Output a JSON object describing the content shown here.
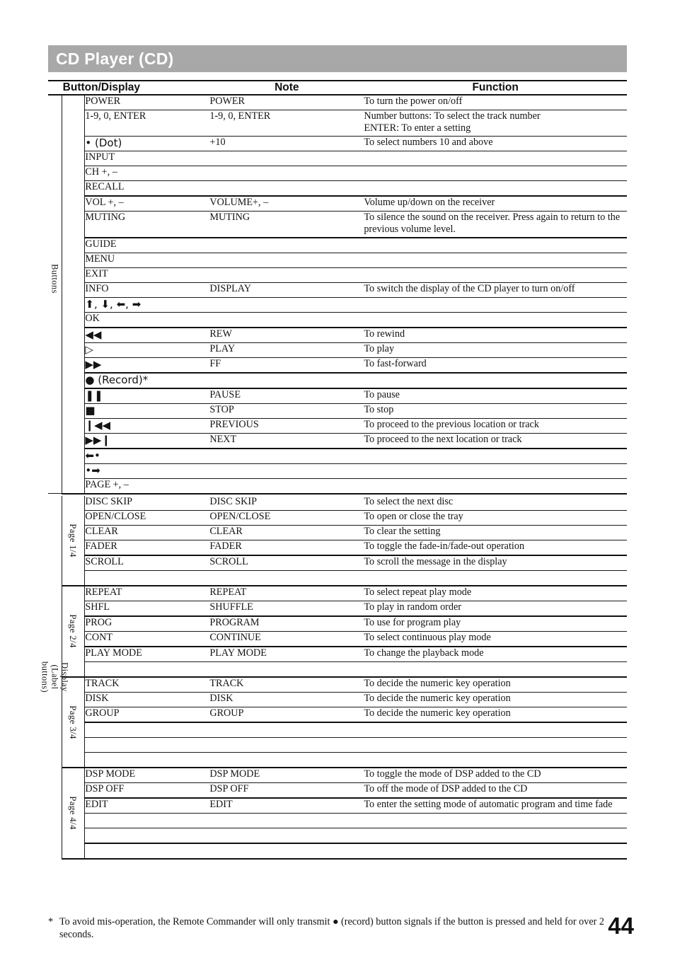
{
  "banner": {
    "title": "CD Player (CD)"
  },
  "headers": {
    "col1": "Button/Display",
    "col2": "Note",
    "col3": "Function"
  },
  "section_labels": {
    "buttons": "Buttons",
    "display": "Display\n(Label buttons)"
  },
  "page_labels": {
    "p1": "Page 1/4",
    "p2": "Page 2/4",
    "p3": "Page 3/4",
    "p4": "Page 4/4"
  },
  "buttons_rows": [
    {
      "bd": "POWER",
      "note": "POWER",
      "fn": "To turn the power on/off"
    },
    {
      "bd": "1-9, 0, ENTER",
      "note": "1-9, 0, ENTER",
      "fn": "Number buttons: To select the track number\nENTER: To enter a setting"
    },
    {
      "bd": "• (Dot)",
      "note": "+10",
      "fn": "To select numbers 10 and above"
    },
    {
      "bd": "INPUT",
      "note": "",
      "fn": ""
    },
    {
      "bd": "CH +, –",
      "note": "",
      "fn": ""
    },
    {
      "bd": "RECALL",
      "note": "",
      "fn": ""
    },
    {
      "bd": "VOL +, –",
      "note": "VOLUME+, –",
      "fn": "Volume up/down on the receiver"
    },
    {
      "bd": "MUTING",
      "note": "MUTING",
      "fn": "To silence the sound on the receiver. Press again to return to the\nprevious volume level."
    },
    {
      "bd": "GUIDE",
      "note": "",
      "fn": ""
    },
    {
      "bd": "MENU",
      "note": "",
      "fn": ""
    },
    {
      "bd": "EXIT",
      "note": "",
      "fn": ""
    },
    {
      "bd": "INFO",
      "note": "DISPLAY",
      "fn": "To switch the display of the CD player to turn on/off"
    },
    {
      "bd": "⬆, ⬇, ⬅, ➡",
      "note": "",
      "fn": ""
    },
    {
      "bd": "OK",
      "note": "",
      "fn": ""
    },
    {
      "bd": "◀◀",
      "note": "REW",
      "fn": "To rewind"
    },
    {
      "bd": "▷",
      "note": "PLAY",
      "fn": "To play"
    },
    {
      "bd": "▶▶",
      "note": "FF",
      "fn": "To fast-forward"
    },
    {
      "bd": "● (Record)*",
      "note": "",
      "fn": ""
    },
    {
      "bd": "❚❚",
      "note": "PAUSE",
      "fn": "To pause"
    },
    {
      "bd": "■",
      "note": "STOP",
      "fn": "To stop"
    },
    {
      "bd": "❙◀◀",
      "note": "PREVIOUS",
      "fn": "To proceed to the previous location or track"
    },
    {
      "bd": "▶▶❙",
      "note": "NEXT",
      "fn": "To proceed to the next location or track"
    },
    {
      "bd": "⬅•",
      "note": "",
      "fn": ""
    },
    {
      "bd": "•➡",
      "note": "",
      "fn": ""
    },
    {
      "bd": "PAGE +, –",
      "note": "",
      "fn": ""
    }
  ],
  "page1_rows": [
    {
      "bd": "DISC SKIP",
      "note": "DISC SKIP",
      "fn": "To select the next disc"
    },
    {
      "bd": "OPEN/CLOSE",
      "note": "OPEN/CLOSE",
      "fn": "To open or close the tray"
    },
    {
      "bd": "CLEAR",
      "note": "CLEAR",
      "fn": "To clear the setting"
    },
    {
      "bd": "FADER",
      "note": "FADER",
      "fn": "To toggle the fade-in/fade-out operation"
    },
    {
      "bd": "SCROLL",
      "note": "SCROLL",
      "fn": "To scroll the message in the display"
    },
    {
      "bd": "",
      "note": "",
      "fn": ""
    }
  ],
  "page2_rows": [
    {
      "bd": "REPEAT",
      "note": "REPEAT",
      "fn": "To select repeat play mode"
    },
    {
      "bd": "SHFL",
      "note": "SHUFFLE",
      "fn": "To play in random order"
    },
    {
      "bd": "PROG",
      "note": "PROGRAM",
      "fn": "To use for program play"
    },
    {
      "bd": "CONT",
      "note": "CONTINUE",
      "fn": "To select continuous play mode"
    },
    {
      "bd": "PLAY MODE",
      "note": "PLAY MODE",
      "fn": "To change the playback mode"
    },
    {
      "bd": "",
      "note": "",
      "fn": ""
    }
  ],
  "page3_rows": [
    {
      "bd": "TRACK",
      "note": "TRACK",
      "fn": "To decide the numeric key operation"
    },
    {
      "bd": "DISK",
      "note": "DISK",
      "fn": "To decide the numeric key operation"
    },
    {
      "bd": "GROUP",
      "note": "GROUP",
      "fn": "To decide the numeric key operation"
    },
    {
      "bd": "",
      "note": "",
      "fn": ""
    },
    {
      "bd": "",
      "note": "",
      "fn": ""
    },
    {
      "bd": "",
      "note": "",
      "fn": ""
    }
  ],
  "page4_rows": [
    {
      "bd": "DSP MODE",
      "note": "DSP MODE",
      "fn": "To toggle the mode of DSP added to the CD"
    },
    {
      "bd": "DSP OFF",
      "note": "DSP OFF",
      "fn": "To off the mode of DSP added to the CD"
    },
    {
      "bd": "EDIT",
      "note": "EDIT",
      "fn": "To enter the setting mode of automatic program and time fade"
    },
    {
      "bd": "",
      "note": "",
      "fn": ""
    },
    {
      "bd": "",
      "note": "",
      "fn": ""
    },
    {
      "bd": "",
      "note": "",
      "fn": ""
    }
  ],
  "footnote": {
    "marker": "*",
    "text": "To avoid mis-operation, the Remote Commander will only transmit ● (record) button signals if the button is pressed and held for over 2 seconds."
  },
  "folio": "44",
  "colors": {
    "banner_bg": "#a8a8a8",
    "banner_text": "#ffffff",
    "rule": "#1a1a1a",
    "ink": "#141414"
  }
}
